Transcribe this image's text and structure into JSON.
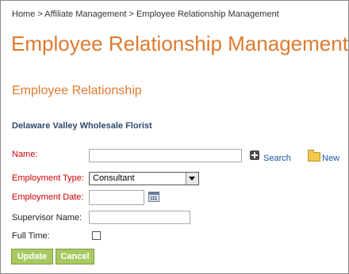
{
  "breadcrumb": {
    "home": "Home >",
    "affiliate": "Affiliate Management >",
    "current": "Employee Relationship Management"
  },
  "page_title": "Employee Relationship Management",
  "section_title": "Employee Relationship",
  "company_name": "Delaware Valley Wholesale Florist",
  "form": {
    "name_label": "Name:",
    "name_value": "",
    "search_label": "Search",
    "new_label": "New",
    "employment_type_label": "Employment Type:",
    "employment_type_value": "Consultant",
    "employment_date_label": "Employment Date:",
    "employment_date_value": "",
    "supervisor_label": "Supervisor Name:",
    "supervisor_value": "",
    "full_time_label": "Full Time:",
    "full_time_checked": false
  },
  "buttons": {
    "update": "Update",
    "cancel": "Cancel"
  },
  "colors": {
    "title": "#e07a2f",
    "required_label": "#cc0000",
    "company": "#2d4a6b",
    "button": "#a8c962"
  }
}
